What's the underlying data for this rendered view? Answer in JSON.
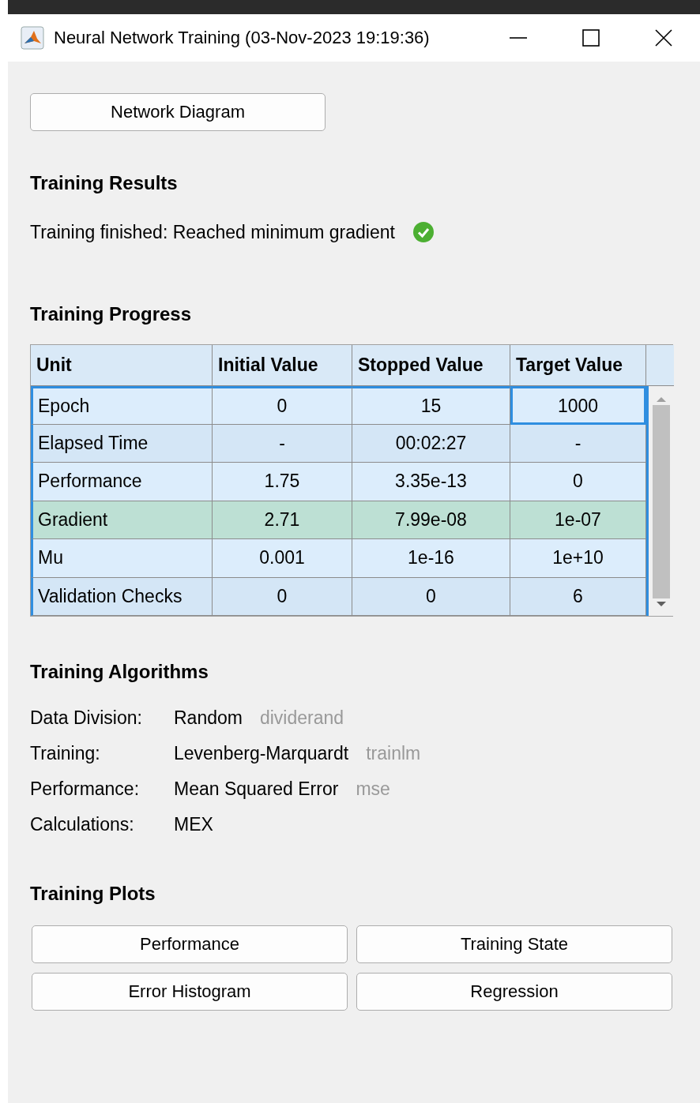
{
  "window": {
    "title": "Neural Network Training (03-Nov-2023 19:19:36)"
  },
  "top_button": {
    "label": "Network Diagram"
  },
  "results": {
    "heading": "Training Results",
    "message": "Training finished: Reached minimum gradient",
    "success": true
  },
  "progress": {
    "heading": "Training Progress",
    "columns": [
      "Unit",
      "Initial Value",
      "Stopped Value",
      "Target Value"
    ],
    "rows": [
      {
        "highlighted": false,
        "cells": [
          {
            "text": "Epoch",
            "focused": false
          },
          {
            "text": "0",
            "focused": false
          },
          {
            "text": "15",
            "focused": false
          },
          {
            "text": "1000",
            "focused": true
          }
        ]
      },
      {
        "highlighted": false,
        "cells": [
          {
            "text": "Elapsed Time",
            "focused": false
          },
          {
            "text": "-",
            "focused": false
          },
          {
            "text": "00:02:27",
            "focused": false
          },
          {
            "text": "-",
            "focused": false
          }
        ]
      },
      {
        "highlighted": false,
        "cells": [
          {
            "text": "Performance",
            "focused": false
          },
          {
            "text": "1.75",
            "focused": false
          },
          {
            "text": "3.35e-13",
            "focused": false
          },
          {
            "text": "0",
            "focused": false
          }
        ]
      },
      {
        "highlighted": true,
        "cells": [
          {
            "text": "Gradient",
            "focused": false
          },
          {
            "text": "2.71",
            "focused": false
          },
          {
            "text": "7.99e-08",
            "focused": false
          },
          {
            "text": "1e-07",
            "focused": false
          }
        ]
      },
      {
        "highlighted": false,
        "cells": [
          {
            "text": "Mu",
            "focused": false
          },
          {
            "text": "0.001",
            "focused": false
          },
          {
            "text": "1e-16",
            "focused": false
          },
          {
            "text": "1e+10",
            "focused": false
          }
        ]
      },
      {
        "highlighted": false,
        "cells": [
          {
            "text": "Validation Checks",
            "focused": false
          },
          {
            "text": "0",
            "focused": false
          },
          {
            "text": "0",
            "focused": false
          },
          {
            "text": "6",
            "focused": false
          }
        ]
      }
    ]
  },
  "algorithms": {
    "heading": "Training Algorithms",
    "items": [
      {
        "label": "Data Division:",
        "value": "Random",
        "function": "dividerand"
      },
      {
        "label": "Training:",
        "value": "Levenberg-Marquardt",
        "function": "trainlm"
      },
      {
        "label": "Performance:",
        "value": "Mean Squared Error",
        "function": "mse"
      },
      {
        "label": "Calculations:",
        "value": "MEX"
      }
    ]
  },
  "plots": {
    "heading": "Training Plots",
    "buttons": [
      "Performance",
      "Training State",
      "Error Histogram",
      "Regression"
    ]
  }
}
